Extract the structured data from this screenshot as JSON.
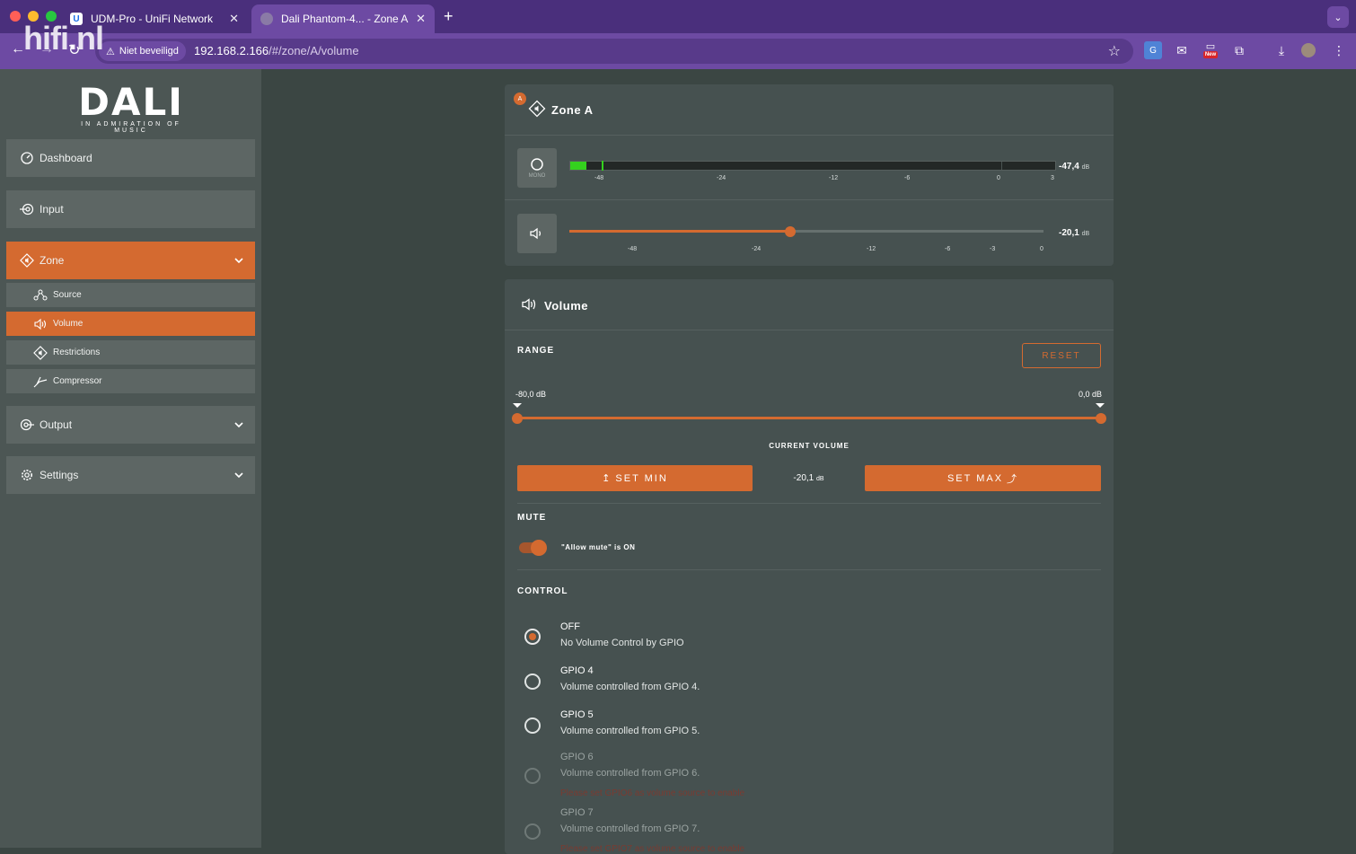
{
  "browser": {
    "tabs": [
      {
        "title": "UDM-Pro - UniFi Network",
        "favicon": "unifi-icon",
        "active": false
      },
      {
        "title": "Dali Phantom-4... - Zone A",
        "favicon": "dali-icon",
        "active": true
      }
    ],
    "security_label": "Niet beveiligd",
    "url_host": "192.168.2.166",
    "url_path": "/#/zone/A/volume",
    "extension_new_badge": "New",
    "watermark": "hifi.nl"
  },
  "sidebar": {
    "logo": {
      "name": "DALI",
      "tagline": "IN ADMIRATION OF MUSIC"
    },
    "items": [
      {
        "label": "Dashboard",
        "icon": "gauge-icon"
      },
      {
        "label": "Input",
        "icon": "input-icon"
      },
      {
        "label": "Zone",
        "icon": "zone-icon",
        "active": true
      },
      {
        "label": "Output",
        "icon": "output-icon"
      },
      {
        "label": "Settings",
        "icon": "gear-icon"
      }
    ],
    "zone_sub": [
      {
        "label": "Source",
        "icon": "source-icon"
      },
      {
        "label": "Volume",
        "icon": "speaker-icon",
        "active": true
      },
      {
        "label": "Restrictions",
        "icon": "restrictions-icon"
      },
      {
        "label": "Compressor",
        "icon": "compressor-icon"
      }
    ]
  },
  "zone_card": {
    "badge": "A",
    "title": "Zone A",
    "mono_label": "MONO",
    "meter": {
      "value": "-47,4",
      "unit": "dB",
      "level_fraction": 0.033,
      "peak_fraction": 0.064,
      "ticks": [
        "-48",
        "-24",
        "-12",
        "-6",
        "0",
        "3"
      ]
    },
    "volume": {
      "value": "-20,1",
      "unit": "dB",
      "level_fraction": 0.465,
      "ticks": [
        "-48",
        "-24",
        "-12",
        "-6",
        "-3",
        "0"
      ]
    }
  },
  "volume_card": {
    "title": "Volume",
    "range": {
      "heading": "RANGE",
      "reset_label": "RESET",
      "min_label": "-80,0 dB",
      "max_label": "0,0 dB",
      "current_volume_heading": "CURRENT VOLUME",
      "current_value": "-20,1",
      "current_unit": "dB",
      "set_min_label": "SET MIN",
      "set_max_label": "SET MAX"
    },
    "mute": {
      "heading": "MUTE",
      "status": "\"Allow mute\" is ON",
      "enabled": true
    },
    "control": {
      "heading": "CONTROL",
      "options": [
        {
          "title": "OFF",
          "desc": "No Volume Control by GPIO",
          "selected": true,
          "disabled": false
        },
        {
          "title": "GPIO 4",
          "desc": "Volume controlled from GPIO 4.",
          "selected": false,
          "disabled": false
        },
        {
          "title": "GPIO 5",
          "desc": "Volume controlled from GPIO 5.",
          "selected": false,
          "disabled": false
        },
        {
          "title": "GPIO 6",
          "desc": "Volume controlled from GPIO 6.",
          "selected": false,
          "disabled": true,
          "warning": "Please set GPIO6 as volume source to enable"
        },
        {
          "title": "GPIO 7",
          "desc": "Volume controlled from GPIO 7.",
          "selected": false,
          "disabled": true,
          "warning": "Please set GPIO7 as volume source to enable"
        }
      ]
    }
  },
  "colors": {
    "accent": "#d46a30",
    "sidebar": "#4c5654",
    "card": "#465150",
    "meter_green": "#34d11e",
    "browser_purple": "#6d4aa3"
  }
}
